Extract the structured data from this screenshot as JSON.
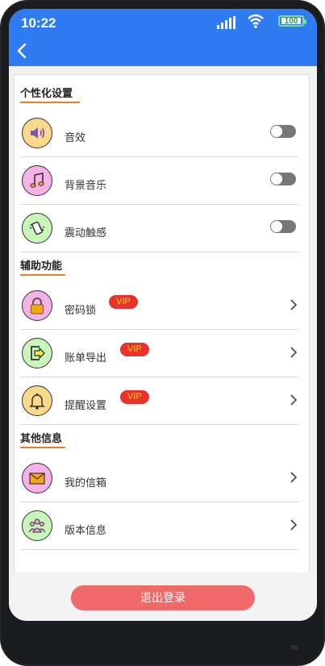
{
  "status_bar": {
    "time": "10:22",
    "battery": "100"
  },
  "colors": {
    "header": "#2e7bf2",
    "accent_underline": "#f07c1f",
    "vip_bg": "#e9322b",
    "vip_text": "#ffd21f",
    "logout_bg": "#f06a6a"
  },
  "sections": [
    {
      "title": "个性化设置",
      "items": [
        {
          "label": "音效",
          "icon": "speaker-icon",
          "control": "toggle",
          "on": false
        },
        {
          "label": "背景音乐",
          "icon": "music-note-icon",
          "control": "toggle",
          "on": false
        },
        {
          "label": "震动触感",
          "icon": "vibrate-icon",
          "control": "toggle",
          "on": false
        }
      ]
    },
    {
      "title": "辅助功能",
      "items": [
        {
          "label": "密码锁",
          "icon": "lock-icon",
          "badge": "VIP",
          "control": "chevron"
        },
        {
          "label": "账单导出",
          "icon": "export-icon",
          "badge": "VIP",
          "control": "chevron"
        },
        {
          "label": "提醒设置",
          "icon": "bell-icon",
          "badge": "VIP",
          "control": "chevron"
        }
      ]
    },
    {
      "title": "其他信息",
      "items": [
        {
          "label": "我的信箱",
          "icon": "envelope-icon",
          "control": "chevron"
        },
        {
          "label": "版本信息",
          "icon": "users-icon",
          "control": "chevron"
        }
      ]
    }
  ],
  "logout_label": "退出登录"
}
